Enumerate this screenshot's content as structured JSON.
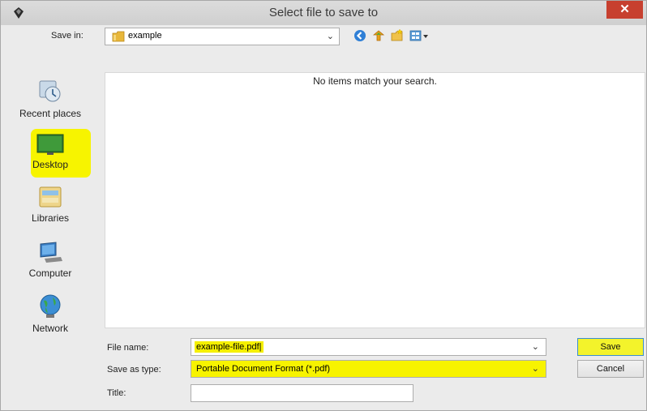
{
  "window": {
    "title": "Select file to save to",
    "close_label": "✕"
  },
  "save_in": {
    "label": "Save in:",
    "value": "example"
  },
  "toolbar": {
    "icons": [
      "back-icon",
      "up-folder-icon",
      "new-folder-icon",
      "view-menu-icon"
    ]
  },
  "places": [
    {
      "label": "Recent places",
      "icon": "recent-places-icon",
      "highlighted": false
    },
    {
      "label": "Desktop",
      "icon": "desktop-icon",
      "highlighted": true
    },
    {
      "label": "Libraries",
      "icon": "libraries-icon",
      "highlighted": false
    },
    {
      "label": "Computer",
      "icon": "computer-icon",
      "highlighted": false
    },
    {
      "label": "Network",
      "icon": "network-icon",
      "highlighted": false
    }
  ],
  "file_list": {
    "empty_message": "No items match your search."
  },
  "form": {
    "file_name_label": "File name:",
    "file_name_value": "example-file.pdf|",
    "save_as_type_label": "Save as type:",
    "save_as_type_value": "Portable Document Format (*.pdf)",
    "title_label": "Title:",
    "title_value": ""
  },
  "buttons": {
    "save": "Save",
    "cancel": "Cancel"
  },
  "colors": {
    "highlight": "#f7f400",
    "close": "#c7402f"
  }
}
